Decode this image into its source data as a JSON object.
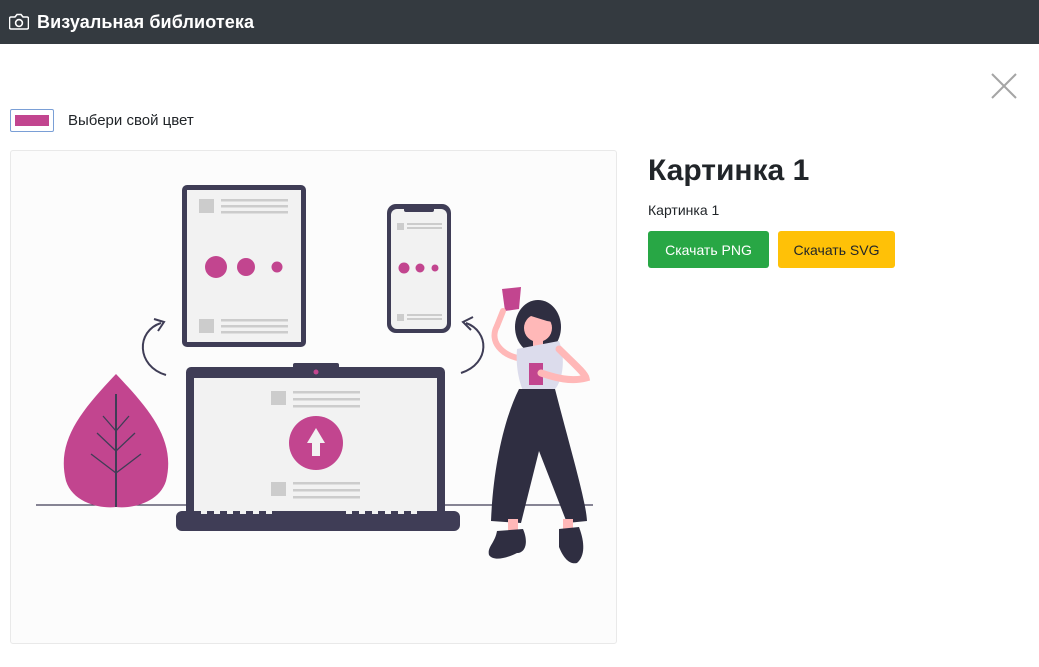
{
  "navbar": {
    "brand": "Визуальная библиотека",
    "icon": "camera-icon"
  },
  "modal": {
    "close_icon": "close-icon",
    "color_label": "Выбери свой цвет",
    "selected_color": "#c2458f",
    "title": "Картинка 1",
    "subtitle": "Картинка 1",
    "download_png": "Скачать PNG",
    "download_svg": "Скачать SVG"
  },
  "colors": {
    "navbar_bg": "#343a40",
    "accent": "#c2458f",
    "png_button": "#28a745",
    "svg_button": "#ffc107",
    "illustration_dark": "#3f3d56"
  }
}
